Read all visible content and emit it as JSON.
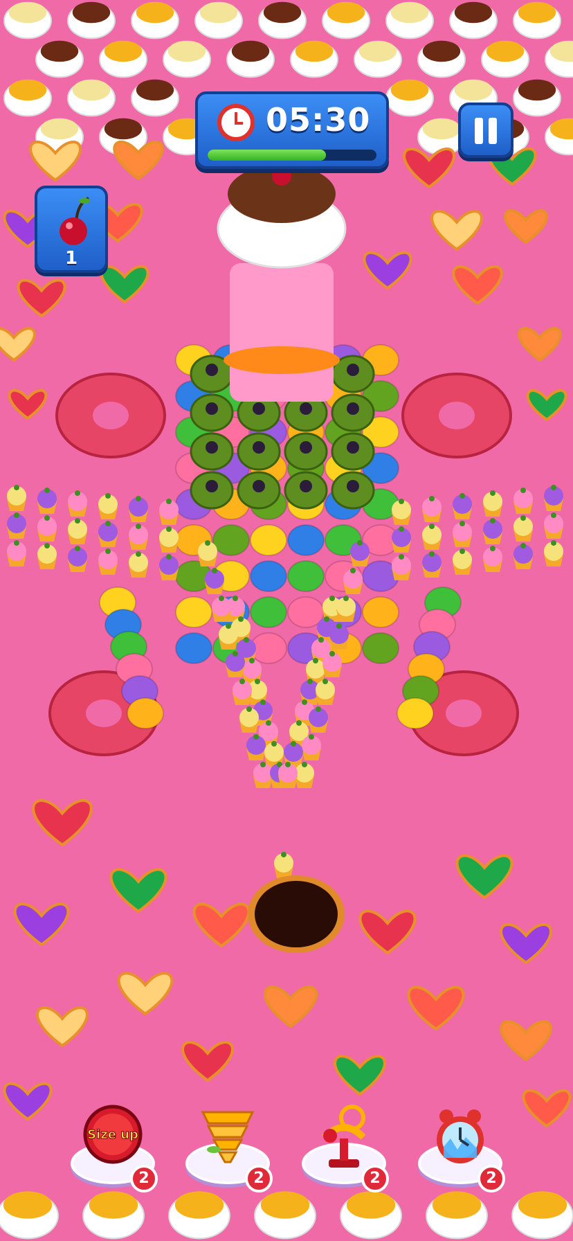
{
  "hud": {
    "timer": {
      "time": "05:30",
      "progress": 0.7,
      "icon": "alarm-clock-icon"
    },
    "pause_icon": "pause-icon",
    "goal": {
      "icon": "cherry-icon",
      "count": "1"
    }
  },
  "boosters": [
    {
      "name": "size-up",
      "icon": "size-up-icon",
      "label": "Size up",
      "count": "2"
    },
    {
      "name": "tornado",
      "icon": "tornado-icon",
      "count": "2"
    },
    {
      "name": "magnet",
      "icon": "magnet-icon",
      "count": "2"
    },
    {
      "name": "freeze-time",
      "icon": "frozen-clock-icon",
      "count": "2"
    }
  ],
  "colors": {
    "background": "#f06aa8",
    "hud_blue": "#2f78e6",
    "badge_red": "#e02a3a",
    "hole": "#2a0c06"
  }
}
